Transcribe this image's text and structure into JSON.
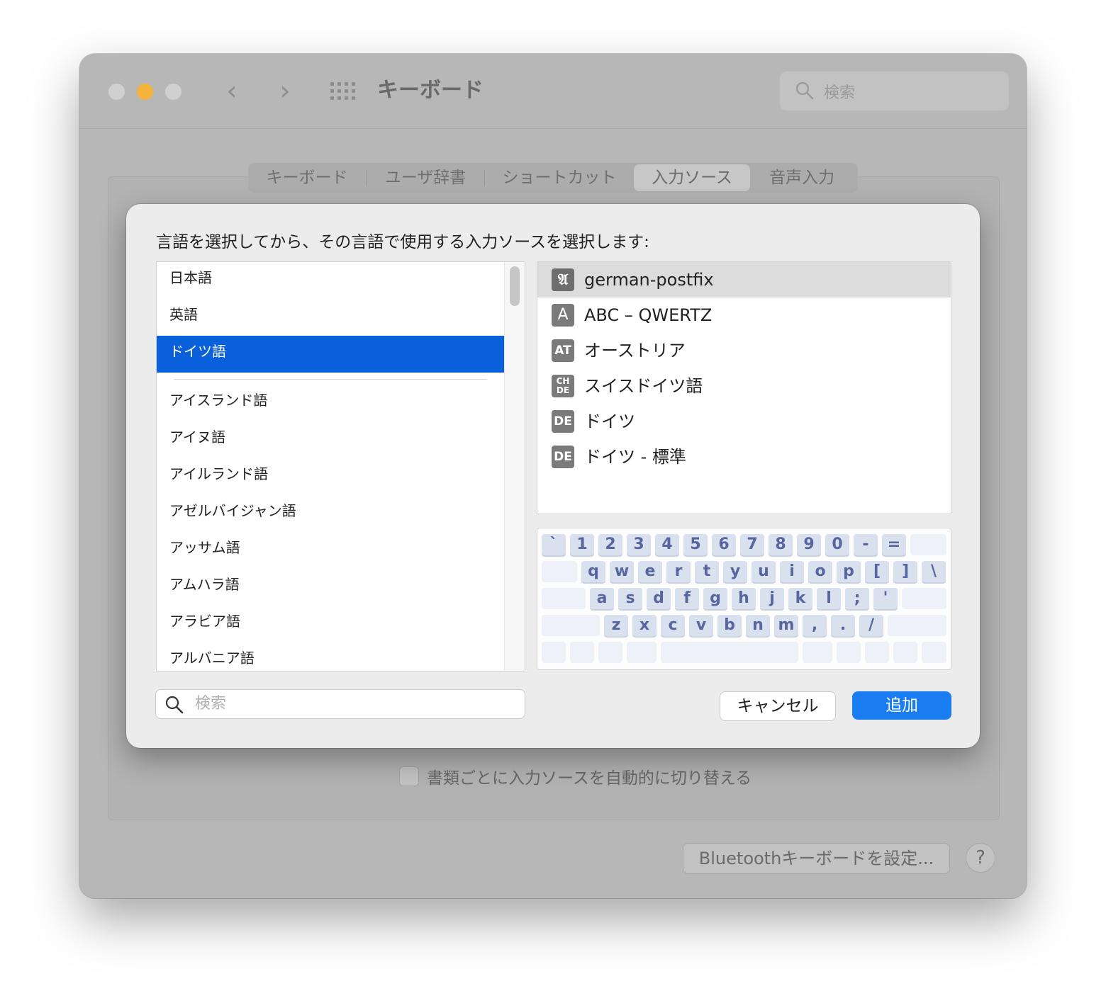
{
  "window": {
    "title": "キーボード",
    "search_placeholder": "検索"
  },
  "tabs": [
    {
      "label": "キーボード"
    },
    {
      "label": "ユーザ辞書"
    },
    {
      "label": "ショートカット"
    },
    {
      "label": "入力ソース",
      "active": true
    },
    {
      "label": "音声入力"
    }
  ],
  "background": {
    "checkbox_label": "書類ごとに入力ソースを自動的に切り替える",
    "bluetooth_button": "Bluetoothキーボードを設定...",
    "help_button": "?"
  },
  "sheet": {
    "prompt": "言語を選択してから、その言語で使用する入力ソースを選択します:",
    "languages_top": [
      "日本語",
      "英語",
      "ドイツ語"
    ],
    "selected_language": "ドイツ語",
    "languages_rest": [
      "アイスランド語",
      "アイヌ語",
      "アイルランド語",
      "アゼルバイジャン語",
      "アッサム語",
      "アムハラ語",
      "アラビア語",
      "アルバニア語"
    ],
    "sources": [
      {
        "badge": "𝔄",
        "label": "german-postfix",
        "selected": true
      },
      {
        "badge": "A",
        "label": "ABC – QWERTZ"
      },
      {
        "badge": "AT",
        "label": "オーストリア"
      },
      {
        "badge": "CH DE",
        "label": "スイスドイツ語"
      },
      {
        "badge": "DE",
        "label": "ドイツ"
      },
      {
        "badge": "DE",
        "label": "ドイツ - 標準"
      }
    ],
    "keyboard_rows": [
      [
        "`",
        "1",
        "2",
        "3",
        "4",
        "5",
        "6",
        "7",
        "8",
        "9",
        "0",
        "-",
        "="
      ],
      [
        "q",
        "w",
        "e",
        "r",
        "t",
        "y",
        "u",
        "i",
        "o",
        "p",
        "[",
        "]",
        "\\"
      ],
      [
        "a",
        "s",
        "d",
        "f",
        "g",
        "h",
        "j",
        "k",
        "l",
        ";",
        "'"
      ],
      [
        "z",
        "x",
        "c",
        "v",
        "b",
        "n",
        "m",
        ",",
        ".",
        "/"
      ]
    ],
    "search_placeholder": "検索",
    "cancel_label": "キャンセル",
    "add_label": "追加",
    "accent_color": "#0a5fdb"
  }
}
